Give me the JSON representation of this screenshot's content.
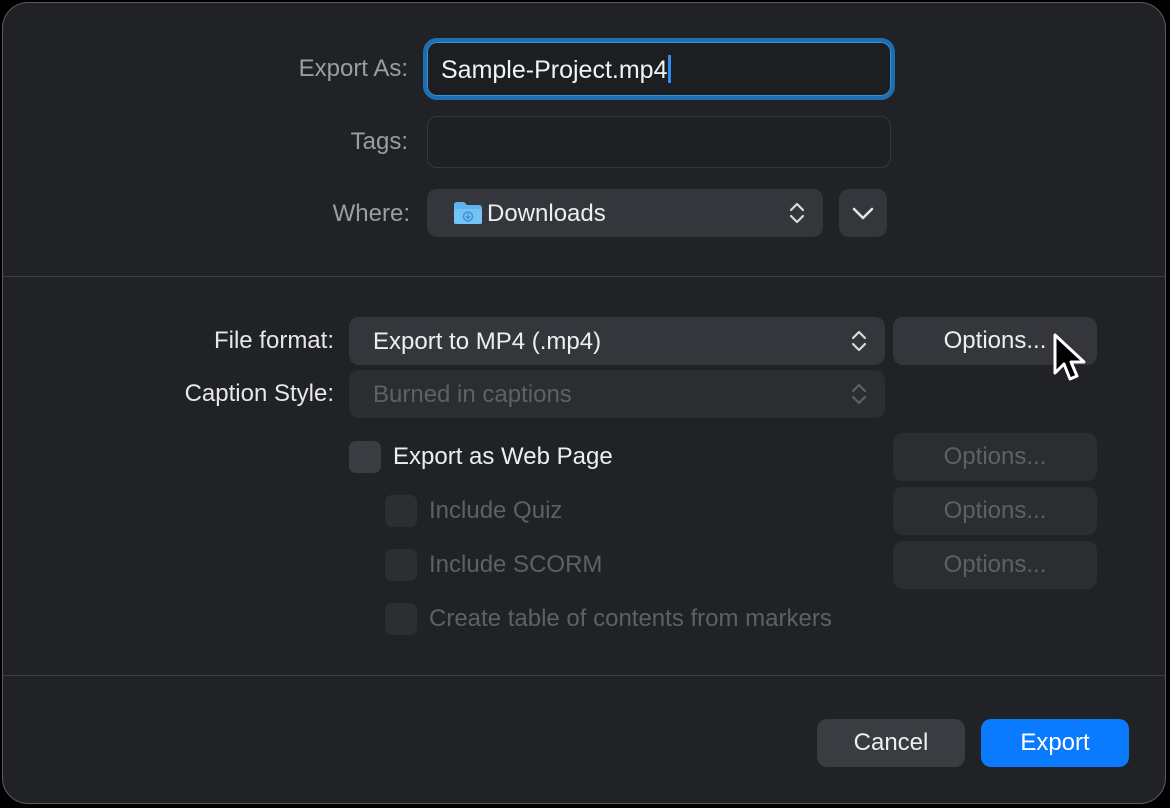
{
  "export_as": {
    "label": "Export As:",
    "value": "Sample-Project.mp4"
  },
  "tags": {
    "label": "Tags:",
    "value": ""
  },
  "where": {
    "label": "Where:",
    "value": "Downloads",
    "folder_icon": "folder-icon",
    "expand_icon": "chevron-down-icon"
  },
  "file_format": {
    "label": "File format:",
    "value": "Export to MP4 (.mp4)",
    "options_label": "Options..."
  },
  "caption_style": {
    "label": "Caption Style:",
    "value": "Burned in captions"
  },
  "web_page": {
    "label": "Export as Web Page",
    "checked": false,
    "options_label": "Options..."
  },
  "include_quiz": {
    "label": "Include Quiz",
    "checked": false,
    "options_label": "Options..."
  },
  "include_scorm": {
    "label": "Include SCORM",
    "checked": false,
    "options_label": "Options..."
  },
  "toc_markers": {
    "label": "Create table of contents from markers",
    "checked": false
  },
  "footer": {
    "cancel_label": "Cancel",
    "export_label": "Export"
  },
  "colors": {
    "accent": "#0a7aff",
    "focus_ring": "#1c6fb3",
    "background": "#202226"
  }
}
